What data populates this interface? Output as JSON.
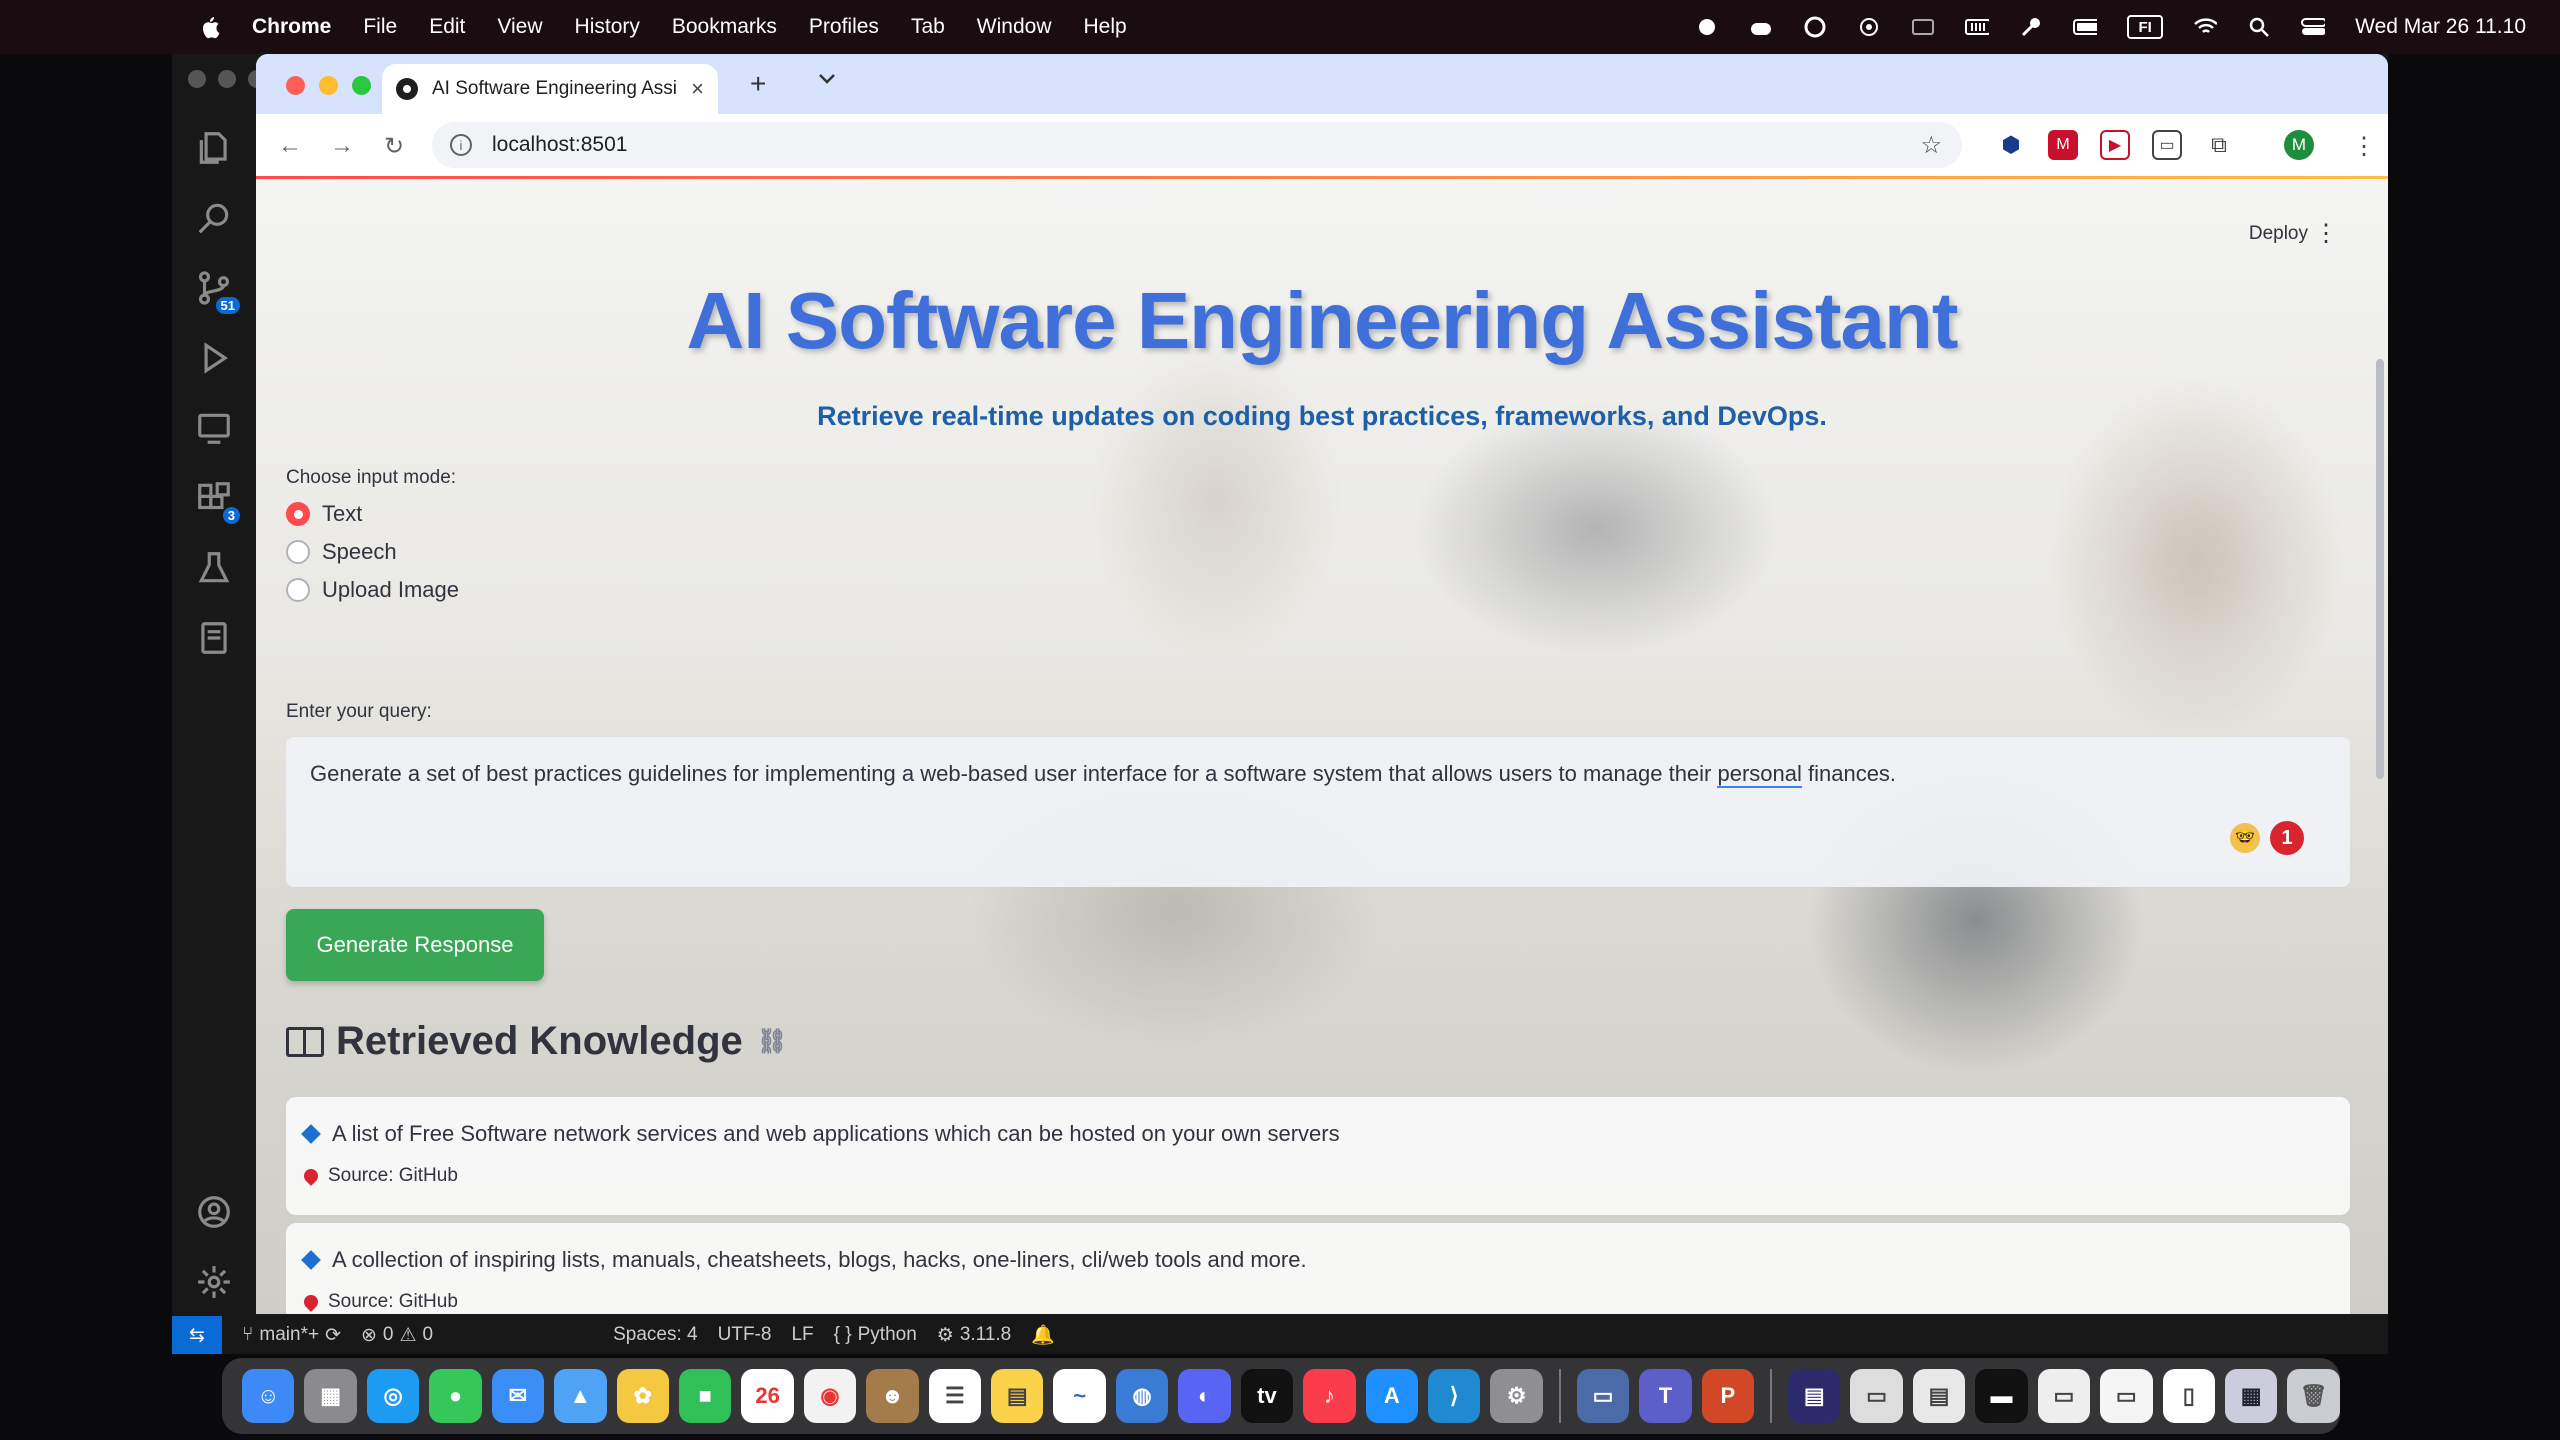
{
  "menubar": {
    "app": "Chrome",
    "items": [
      "File",
      "Edit",
      "View",
      "History",
      "Bookmarks",
      "Profiles",
      "Tab",
      "Window",
      "Help"
    ],
    "status_icons": [
      "record-icon",
      "cloud-icon",
      "vpn-icon",
      "airdrop-icon",
      "screen-icon",
      "memory-icon",
      "key-icon",
      "battery-icon",
      "keyboard-icon",
      "wifi-icon",
      "search-icon",
      "control-center-icon"
    ],
    "input_source": "FI",
    "clock": "Wed Mar 26  11.10"
  },
  "vscode": {
    "activity_badges": {
      "source_control": "51",
      "extensions": "3"
    },
    "status": {
      "branch": "main*+",
      "problems": "0",
      "warnings": "0",
      "spaces": "Spaces: 4",
      "encoding": "UTF-8",
      "eol": "LF",
      "language": "Python",
      "python_version": "3.11.8"
    }
  },
  "browser": {
    "tab_title": "AI Software Engineering Assi",
    "url": "localhost:8501"
  },
  "page": {
    "deploy_label": "Deploy",
    "title": "AI Software Engineering Assistant",
    "subtitle": "Retrieve real-time updates on coding best practices, frameworks, and DevOps.",
    "input_mode_label": "Choose input mode:",
    "input_modes": [
      "Text",
      "Speech",
      "Upload Image"
    ],
    "selected_mode": "Text",
    "query_label": "Enter your query:",
    "query_before": "Generate a set of best practices guidelines for implementing a web-based user interface for a software system that allows users to manage their ",
    "query_underlined": "personal",
    "query_after": " finances.",
    "grammar_count": "1",
    "generate_button": "Generate Response",
    "retrieved_heading": "Retrieved Knowledge",
    "results": [
      {
        "title": "A list of Free Software network services and web applications which can be hosted on your own servers",
        "source": "Source: GitHub"
      },
      {
        "title": "A collection of inspiring lists, manuals, cheatsheets, blogs, hacks, one-liners, cli/web tools and more.",
        "source": "Source: GitHub"
      }
    ]
  }
}
